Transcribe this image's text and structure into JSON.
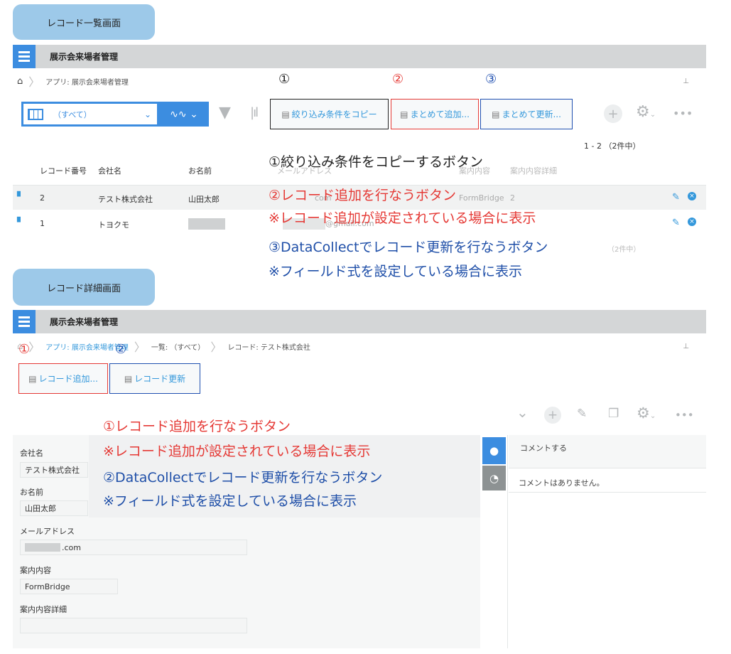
{
  "list_section": {
    "label": "レコード一覧画面",
    "app_title": "展示会来場者管理",
    "breadcrumb": {
      "app": "アプリ: 展示会来場者管理"
    },
    "view_select": "（すべて）",
    "buttons": {
      "copy_filter": "絞り込み条件をコピー",
      "bulk_add": "まとめて追加...",
      "bulk_update": "まとめて更新..."
    },
    "markers": [
      "①",
      "②",
      "③"
    ],
    "pagination": "1 - 2 （2件中）",
    "pagination_bottom": "（2件中）",
    "columns": [
      "レコード番号",
      "会社名",
      "お名前",
      "メールアドレス",
      "案内内容",
      "案内内容詳細"
    ],
    "rows": [
      {
        "id": "2",
        "company": "テスト株式会社",
        "name": "山田太郎",
        "email": "com",
        "guide": "FormBridge",
        "detail": "2"
      },
      {
        "id": "1",
        "company": "トヨクモ",
        "name": "",
        "email": "@gmail.com",
        "guide": "",
        "detail": ""
      }
    ],
    "annotations": {
      "a1": "①絞り込み条件をコピーするボタン",
      "a2": "②レコード追加を行なうボタン",
      "a2_note": "※レコード追加が設定されている場合に表示",
      "a3": "③DataCollectでレコード更新を行なうボタン",
      "a3_note": "※フィールド式を設定している場合に表示"
    }
  },
  "detail_section": {
    "label": "レコード詳細画面",
    "app_title": "展示会来場者管理",
    "breadcrumb": {
      "app": "アプリ: 展示会来場者管理",
      "list": "一覧: （すべて）",
      "record": "レコード: テスト株式会社"
    },
    "markers": [
      "①",
      "②"
    ],
    "buttons": {
      "record_add": "レコード追加...",
      "record_update": "レコード更新"
    },
    "fields": [
      {
        "label": "会社名",
        "value": "テスト株式会社"
      },
      {
        "label": "お名前",
        "value": "山田太郎"
      },
      {
        "label": "メールアドレス",
        "value": ".com"
      },
      {
        "label": "案内内容",
        "value": "FormBridge"
      },
      {
        "label": "案内内容詳細",
        "value": ""
      }
    ],
    "comment": {
      "placeholder": "コメントする",
      "empty": "コメントはありません。"
    },
    "annotations": {
      "a1": "①レコード追加を行なうボタン",
      "a1_note": "※レコード追加が設定されている場合に表示",
      "a2": "②DataCollectでレコード更新を行なうボタン",
      "a2_note": "※フィールド式を設定している場合に表示"
    }
  },
  "colors": {
    "accent": "#3498db",
    "red": "#e53935",
    "blue": "#1f4fa8",
    "appbar": "#d4d6d7",
    "pill": "#9dc9e9"
  }
}
